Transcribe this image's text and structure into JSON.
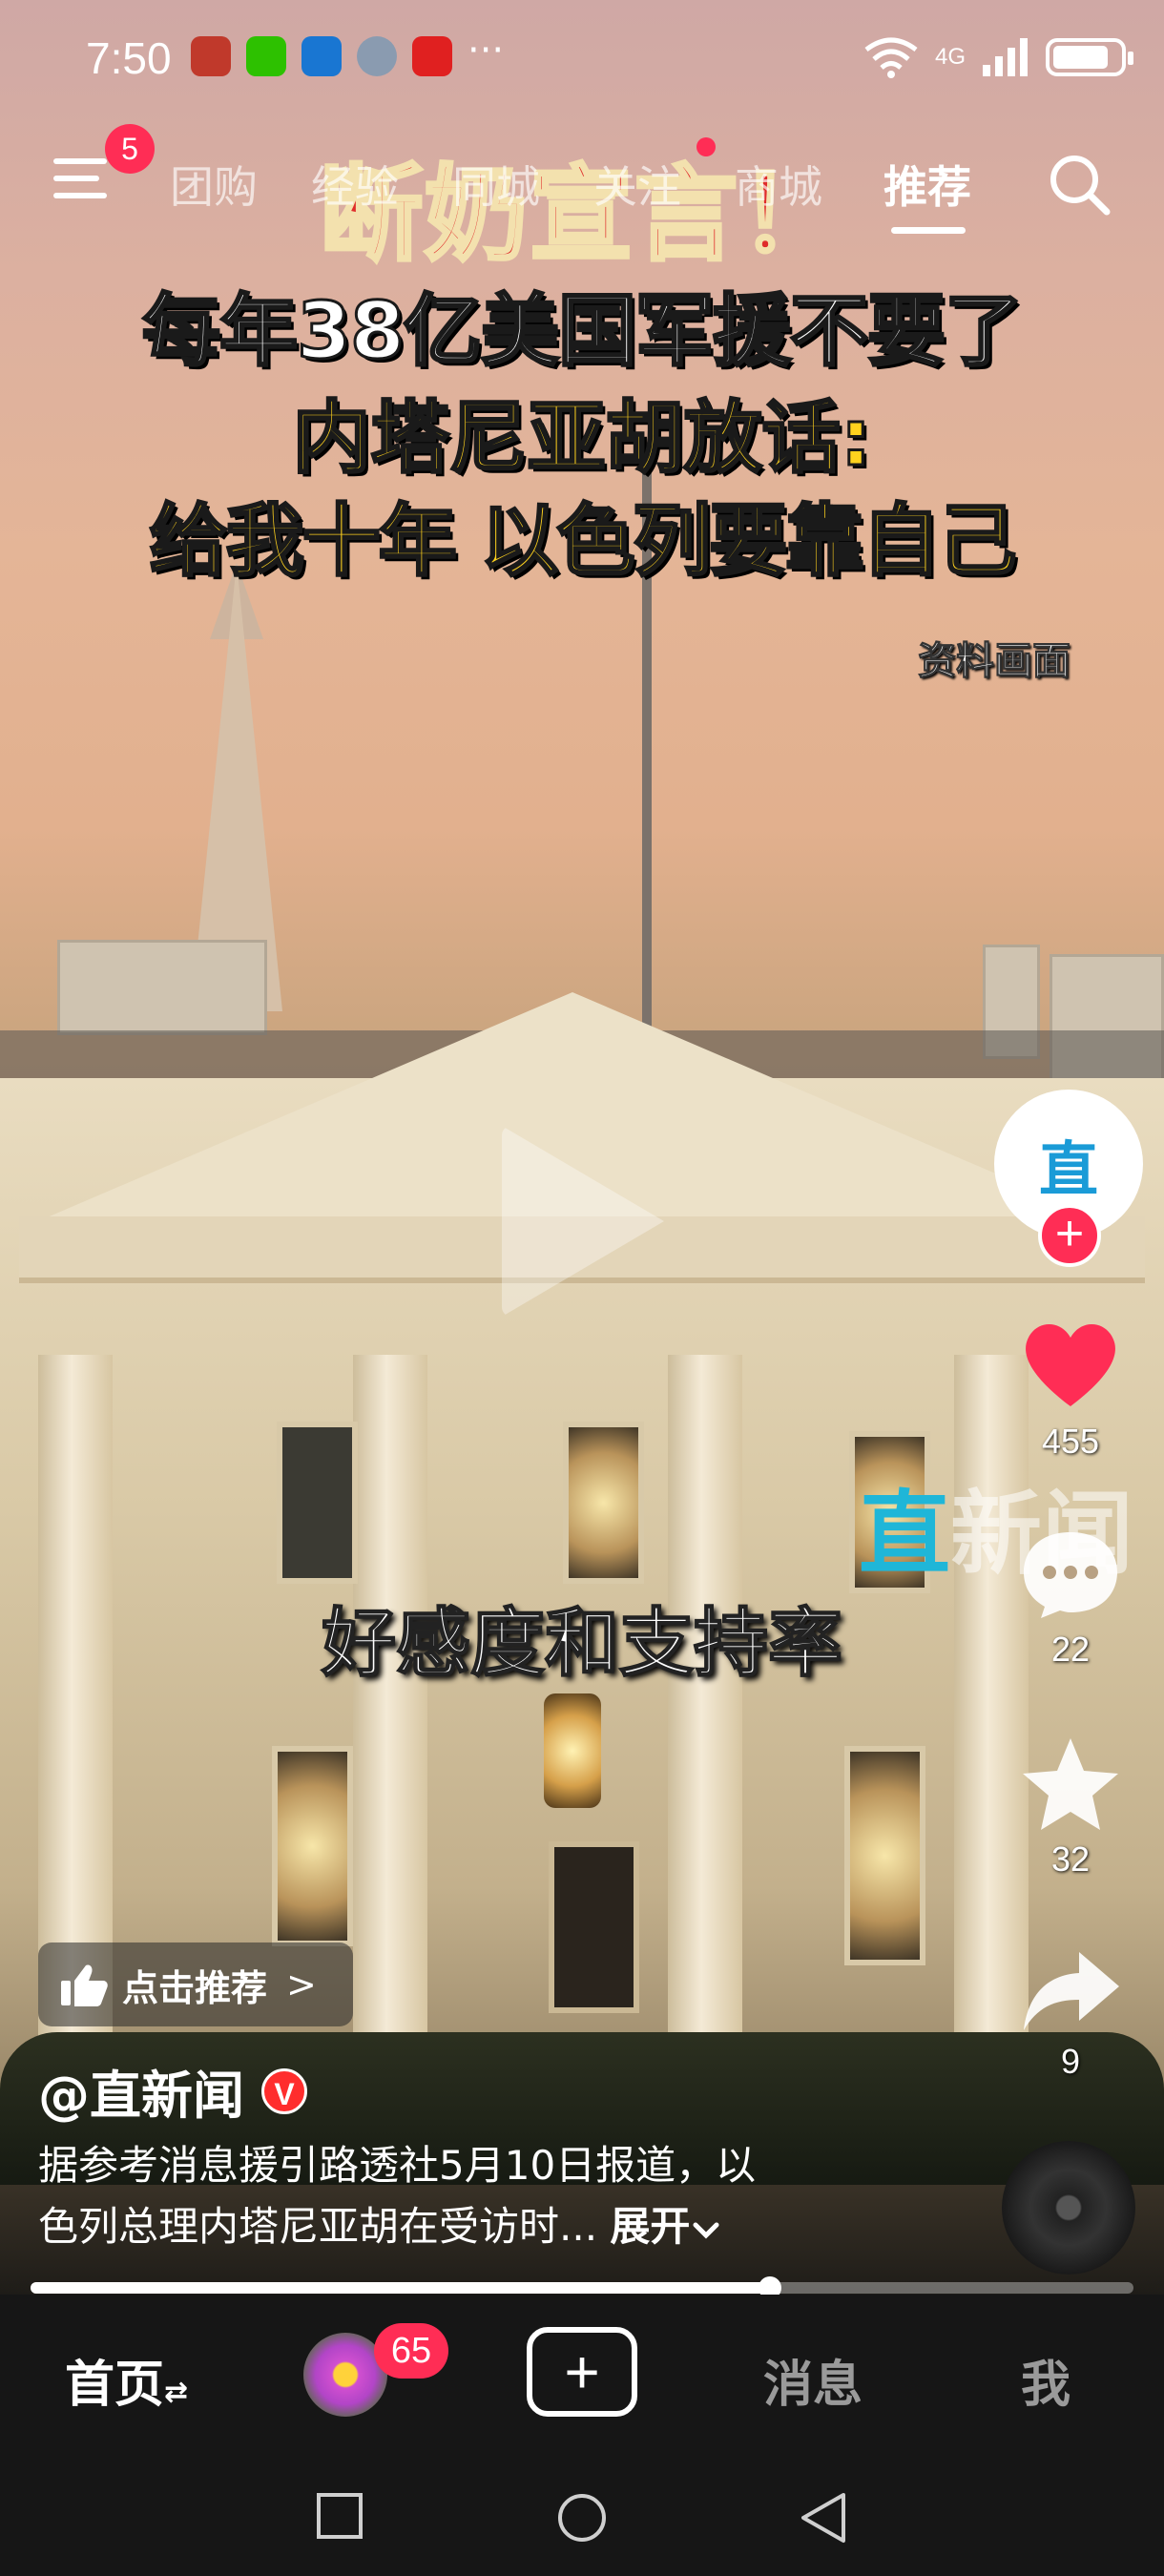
{
  "status_bar": {
    "time": "7:50",
    "overflow": "···",
    "signal_label": "4G",
    "wifi_label": "6",
    "battery_level": 0.85
  },
  "top_nav": {
    "menu_badge": "5",
    "tabs": [
      {
        "label": "团购",
        "active": false
      },
      {
        "label": "经验",
        "active": false
      },
      {
        "label": "同城",
        "active": false
      },
      {
        "label": "关注",
        "active": false
      },
      {
        "label": "商城",
        "active": false
      },
      {
        "label": "推荐",
        "active": true
      }
    ]
  },
  "video": {
    "headline_red": "断奶宣言！",
    "headline_white": "每年38亿美国军援不要了",
    "headline_yellow_1": "内塔尼亚胡放话:",
    "headline_yellow_2": "给我十年 以色列要靠自己",
    "archive_label": "资料画面",
    "subtitle": "好感度和支持率",
    "watermark_zhi": "直",
    "watermark_rest": "新闻",
    "progress": 0.67
  },
  "right_rail": {
    "avatar_char": "直",
    "follow_symbol": "+",
    "likes": "455",
    "comments": "22",
    "favorites": "32",
    "shares": "9",
    "colors": {
      "like": "#ff2d55",
      "follow": "#ff2d55",
      "avatar_text": "#1a9bd7"
    }
  },
  "info": {
    "recommend_label": "点击推荐",
    "recommend_chevron": ">",
    "author": "@直新闻",
    "verified_badge": "V",
    "description_line1": "据参考消息援引路透社5月10日报道，以",
    "description_line2": "色列总理内塔尼亚胡在受访时...",
    "expand_label": "展开"
  },
  "bottom_tabs": {
    "home_label": "首页",
    "home_arrows": "⇄",
    "friend_badge": "65",
    "post_symbol": "+",
    "messages_label": "消息",
    "me_label": "我"
  }
}
